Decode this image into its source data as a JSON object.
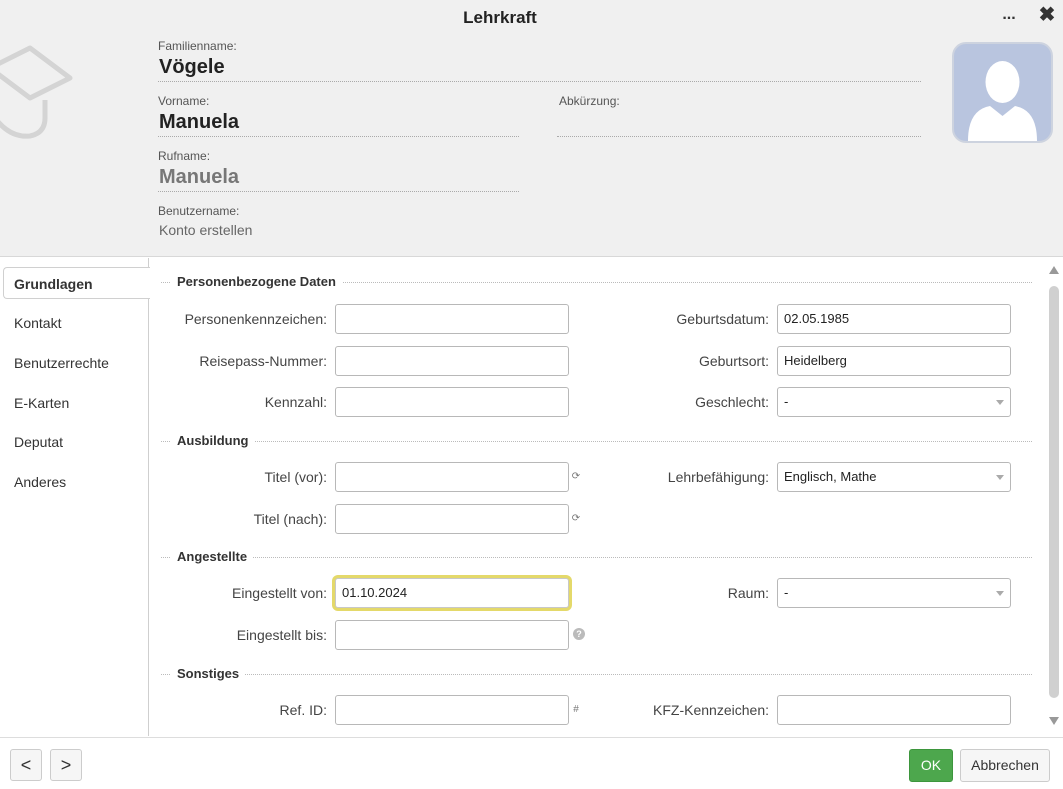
{
  "window": {
    "title": "Lehrkraft",
    "more_icon": "more-horizontal-icon",
    "more_label": "...",
    "close_icon": "close-icon",
    "close_label": "✖"
  },
  "header": {
    "logo_icon": "graduation-cap-icon",
    "familienname": {
      "label": "Familienname:",
      "value": "Vögele"
    },
    "vorname": {
      "label": "Vorname:",
      "value": "Manuela"
    },
    "abkuerzung": {
      "label": "Abkürzung:",
      "value": ""
    },
    "rufname": {
      "label": "Rufname:",
      "value": "Manuela"
    },
    "benutzername": {
      "label": "Benutzername:",
      "link": "Konto erstellen"
    },
    "avatar_icon": "user-silhouette-icon"
  },
  "sidebar": {
    "items": [
      {
        "label": "Grundlagen",
        "active": true
      },
      {
        "label": "Kontakt"
      },
      {
        "label": "Benutzerrechte"
      },
      {
        "label": "E-Karten"
      },
      {
        "label": "Deputat"
      },
      {
        "label": "Anderes"
      }
    ]
  },
  "sections": {
    "personal": {
      "title": "Personenbezogene Daten",
      "personenkennzeichen": {
        "label": "Personenkennzeichen:",
        "value": ""
      },
      "geburtsdatum": {
        "label": "Geburtsdatum:",
        "value": "02.05.1985"
      },
      "reisepass": {
        "label": "Reisepass-Nummer:",
        "value": ""
      },
      "geburtsort": {
        "label": "Geburtsort:",
        "value": "Heidelberg"
      },
      "kennzahl": {
        "label": "Kennzahl:",
        "value": ""
      },
      "geschlecht": {
        "label": "Geschlecht:",
        "value": "-"
      }
    },
    "ausbildung": {
      "title": "Ausbildung",
      "titel_vor": {
        "label": "Titel (vor):",
        "value": "",
        "icon": "refresh-icon",
        "icon_glyph": "⟳"
      },
      "lehrbefaehigung": {
        "label": "Lehrbefähigung:",
        "value": "Englisch, Mathe"
      },
      "titel_nach": {
        "label": "Titel (nach):",
        "value": "",
        "icon": "refresh-icon",
        "icon_glyph": "⟳"
      }
    },
    "angestellte": {
      "title": "Angestellte",
      "eingestellt_von": {
        "label": "Eingestellt von:",
        "value": "01.10.2024"
      },
      "raum": {
        "label": "Raum:",
        "value": "-"
      },
      "eingestellt_bis": {
        "label": "Eingestellt bis:",
        "value": "",
        "icon": "help-icon",
        "icon_glyph": "?"
      }
    },
    "sonstiges": {
      "title": "Sonstiges",
      "ref_id": {
        "label": "Ref. ID:",
        "value": "",
        "icon": "hash-icon",
        "icon_glyph": "#"
      },
      "kfz": {
        "label": "KFZ-Kennzeichen:",
        "value": ""
      }
    }
  },
  "footer": {
    "prev_label": "<",
    "next_label": ">",
    "ok_label": "OK",
    "cancel_label": "Abbrechen"
  },
  "colors": {
    "header_bg": "#f0f0f0",
    "ok_button": "#4da74d",
    "focus_highlight": "#e4d96a",
    "avatar_bg": "#b9c5df"
  }
}
